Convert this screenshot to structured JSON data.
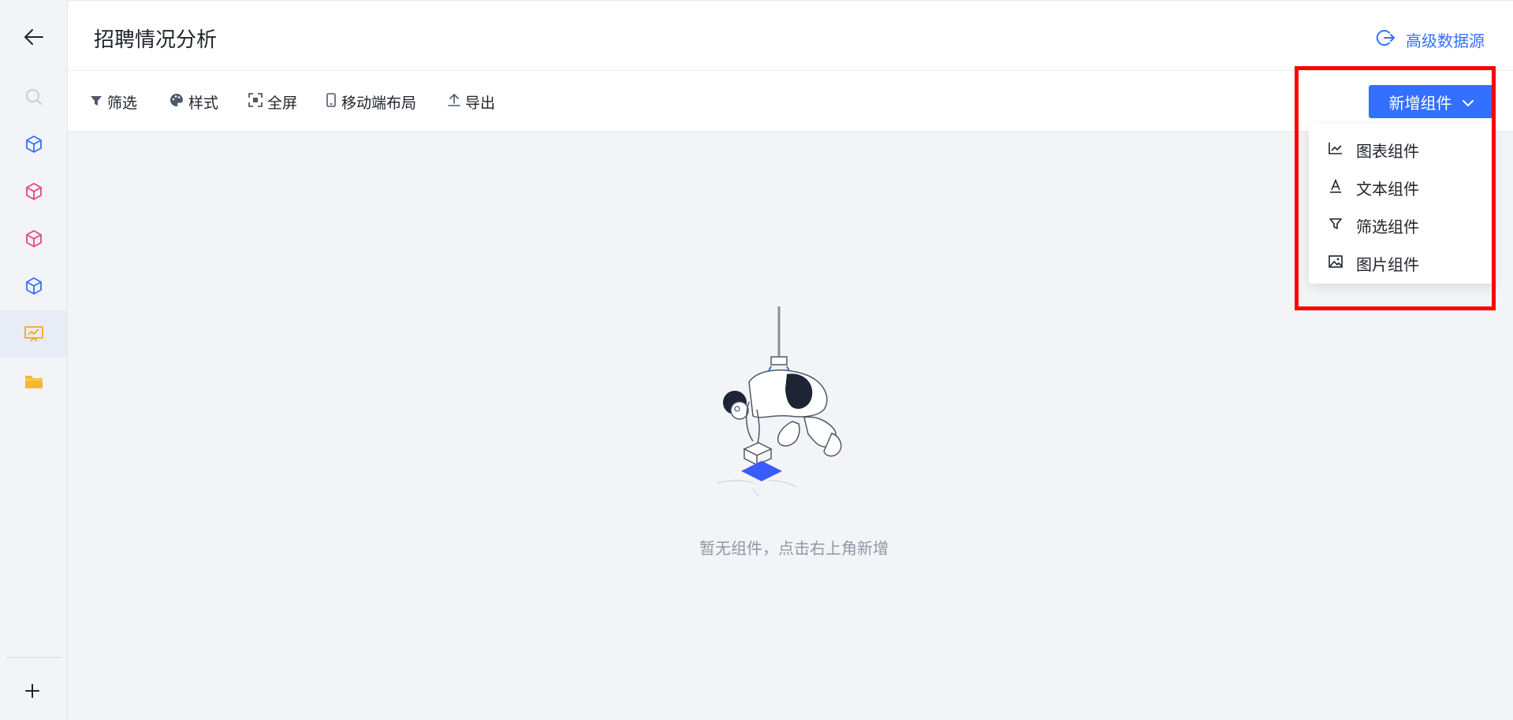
{
  "header": {
    "title": "招聘情况分析",
    "advanced_datasource_label": "高级数据源"
  },
  "sidebar": {
    "items": [
      {
        "icon": "search-icon",
        "color": "#c9ccd2"
      },
      {
        "icon": "cube-icon",
        "color": "#3370ff"
      },
      {
        "icon": "cube-icon",
        "color": "#e8408a"
      },
      {
        "icon": "cube-icon",
        "color": "#e8408a"
      },
      {
        "icon": "cube-icon",
        "color": "#3370ff"
      },
      {
        "icon": "dashboard-icon",
        "color": "#f5a623",
        "active": true
      },
      {
        "icon": "folder-icon",
        "color": "#f7b731"
      }
    ]
  },
  "toolbar": {
    "filter_label": "筛选",
    "style_label": "样式",
    "fullscreen_label": "全屏",
    "mobile_layout_label": "移动端布局",
    "export_label": "导出"
  },
  "add_component": {
    "button_label": "新增组件",
    "menu": [
      {
        "icon": "line-chart-icon",
        "label": "图表组件"
      },
      {
        "icon": "text-icon",
        "label": "文本组件"
      },
      {
        "icon": "filter-icon",
        "label": "筛选组件"
      },
      {
        "icon": "image-icon",
        "label": "图片组件"
      }
    ]
  },
  "empty_state": {
    "message": "暂无组件，点击右上角新增"
  },
  "colors": {
    "accent": "#3370ff",
    "highlight": "#ff0000",
    "canvas_bg": "#f3f4f8"
  }
}
